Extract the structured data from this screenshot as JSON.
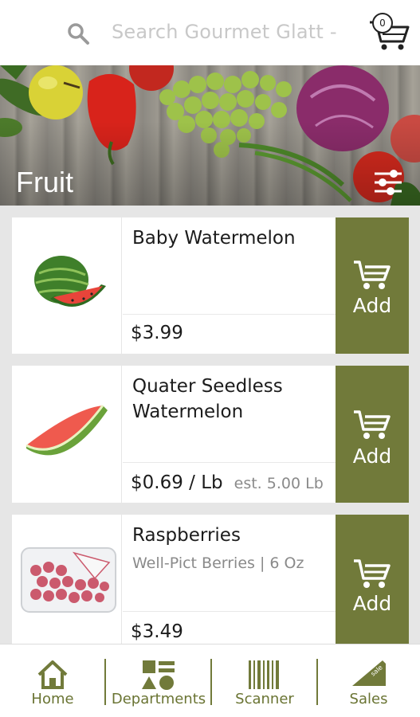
{
  "search": {
    "placeholder": "Search Gourmet Glatt -",
    "icon": "search-icon"
  },
  "cart": {
    "count": "0",
    "icon": "cart-icon"
  },
  "banner": {
    "title": "Fruit",
    "filter_icon": "filter-sliders-icon"
  },
  "products": [
    {
      "name": "Baby Watermelon",
      "subtitle": "",
      "price": "$3.99",
      "estimate": "",
      "add_label": "Add",
      "image": "baby-watermelon"
    },
    {
      "name": "Quater Seedless Watermelon",
      "subtitle": "",
      "price": "$0.69 / Lb",
      "estimate": "est. 5.00 Lb",
      "add_label": "Add",
      "image": "watermelon-slice"
    },
    {
      "name": "Raspberries",
      "subtitle": "Well-Pict Berries | 6 Oz",
      "price": "$3.49",
      "estimate": "",
      "add_label": "Add",
      "image": "raspberries-clamshell"
    }
  ],
  "nav": [
    {
      "label": "Home",
      "icon": "home-icon"
    },
    {
      "label": "Departments",
      "icon": "departments-icon"
    },
    {
      "label": "Scanner",
      "icon": "barcode-icon"
    },
    {
      "label": "Sales",
      "icon": "sale-tag-icon",
      "tag_text": "sale"
    }
  ],
  "colors": {
    "accent": "#717a3a",
    "nav_text": "#6a7433",
    "background": "#e6e6e6"
  }
}
